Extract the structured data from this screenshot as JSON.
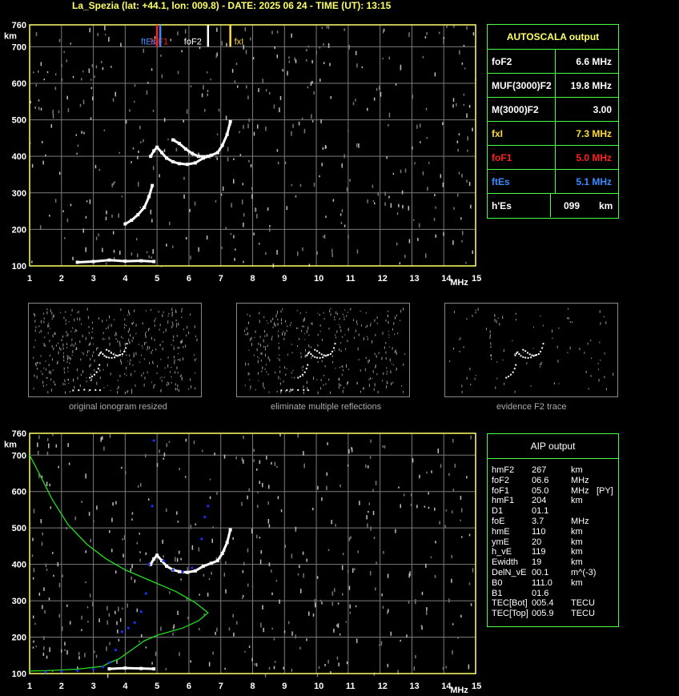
{
  "header": {
    "title": "La_Spezia (lat: +44.1, lon: 009.8) - DATE: 2025 06 24 - TIME (UT): 13:15"
  },
  "colors": {
    "axis": "#ffff66",
    "grid": "#7a7a7a",
    "panel_border": "#44ff44",
    "trace": "#ffffff",
    "foF1": "#ff2020",
    "ftEs": "#3a8cff",
    "fxI": "#ffdd33",
    "profile": "#22dd22",
    "aip_points": "#1a2fff"
  },
  "autoscala": {
    "title": "AUTOSCALA output",
    "rows": [
      {
        "key": "foF2",
        "value": "6.6 MHz",
        "color": "#ffffff"
      },
      {
        "key": "MUF(3000)F2",
        "value": "19.8 MHz",
        "color": "#ffffff"
      },
      {
        "key": "M(3000)F2",
        "value": "3.00",
        "color": "#ffffff"
      },
      {
        "key": "fxI",
        "value": "7.3 MHz",
        "color": "#ffdd33"
      },
      {
        "key": "foF1",
        "value": "5.0 MHz",
        "color": "#ff2020"
      },
      {
        "key": "ftEs",
        "value": "5.1 MHz",
        "color": "#3a8cff"
      },
      {
        "key": "h'Es",
        "value": "099",
        "unit": "km",
        "color": "#ffffff"
      }
    ]
  },
  "aip": {
    "title": "AIP output",
    "rows": [
      [
        "hmF2",
        "267",
        "km",
        ""
      ],
      [
        "foF2",
        "06.6",
        "MHz",
        ""
      ],
      [
        "foF1",
        "05.0",
        "MHz",
        "[PY]"
      ],
      [
        "hmF1",
        "204",
        "km",
        ""
      ],
      [
        "D1",
        "01.1",
        "",
        ""
      ],
      [
        "foE",
        "3.7",
        "MHz",
        ""
      ],
      [
        "hmE",
        "110",
        "km",
        ""
      ],
      [
        "ymE",
        "20",
        "km",
        ""
      ],
      [
        "h_vE",
        "119",
        "km",
        ""
      ],
      [
        "Ewidth",
        "19",
        "km",
        ""
      ],
      [
        "DelN_vE",
        "00.1",
        "m^(-3)",
        ""
      ],
      [
        "B0",
        "111.0",
        "km",
        ""
      ],
      [
        "B1",
        "01.6",
        "",
        ""
      ],
      [
        "TEC[Bot]",
        "005.4",
        "TECU",
        ""
      ],
      [
        "TEC[Top]",
        "005.9",
        "TECU",
        ""
      ]
    ]
  },
  "thumbnails": [
    {
      "caption": "original ionogram resized"
    },
    {
      "caption": "eliminate multiple reflections"
    },
    {
      "caption": "evidence F2 trace"
    }
  ],
  "chart_data": [
    {
      "type": "scatter",
      "name": "ionogram_top",
      "xunit": "MHz",
      "yunit": "km",
      "xlim": [
        1,
        15
      ],
      "ylim": [
        100,
        760
      ],
      "xticks": [
        "1",
        "2",
        "3",
        "4",
        "5",
        "6",
        "7",
        "8",
        "9",
        "10",
        "11",
        "12",
        "13",
        "14",
        "15"
      ],
      "yticks": [
        "100",
        "200",
        "300",
        "400",
        "500",
        "600",
        "700",
        "760"
      ],
      "markers": [
        {
          "label": "foF1",
          "x": 5.0,
          "color": "#ff2020"
        },
        {
          "label": "ftEs",
          "x": 5.1,
          "color": "#3a8cff"
        },
        {
          "label": "foF2",
          "x": 6.6,
          "color": "#ffffff"
        },
        {
          "label": "fxI",
          "x": 7.3,
          "color": "#ffdd33"
        }
      ],
      "traces": [
        {
          "name": "Es",
          "points": [
            [
              2.5,
              110
            ],
            [
              3.0,
              112
            ],
            [
              3.5,
              116
            ],
            [
              4.0,
              113
            ],
            [
              4.5,
              114
            ],
            [
              4.9,
              112
            ]
          ]
        },
        {
          "name": "F1",
          "points": [
            [
              4.0,
              215
            ],
            [
              4.2,
              225
            ],
            [
              4.4,
              240
            ],
            [
              4.6,
              260
            ],
            [
              4.75,
              290
            ],
            [
              4.85,
              320
            ]
          ]
        },
        {
          "name": "F2",
          "points": [
            [
              4.8,
              400
            ],
            [
              4.9,
              415
            ],
            [
              5.0,
              425
            ],
            [
              5.15,
              410
            ],
            [
              5.3,
              395
            ],
            [
              5.5,
              385
            ],
            [
              5.7,
              380
            ],
            [
              5.95,
              378
            ],
            [
              6.2,
              382
            ],
            [
              6.45,
              395
            ],
            [
              6.7,
              403
            ],
            [
              6.9,
              410
            ],
            [
              7.05,
              430
            ],
            [
              7.2,
              460
            ],
            [
              7.3,
              495
            ]
          ]
        },
        {
          "name": "F2x",
          "points": [
            [
              5.5,
              445
            ],
            [
              5.7,
              435
            ],
            [
              5.9,
              420
            ],
            [
              6.1,
              408
            ],
            [
              6.3,
              400
            ],
            [
              6.6,
              400
            ]
          ]
        }
      ]
    },
    {
      "type": "scatter",
      "name": "ionogram_bottom",
      "xunit": "MHz",
      "yunit": "km",
      "xlim": [
        1,
        15
      ],
      "ylim": [
        100,
        760
      ],
      "xticks": [
        "1",
        "2",
        "3",
        "4",
        "5",
        "6",
        "7",
        "8",
        "9",
        "10",
        "11",
        "12",
        "13",
        "14",
        "15"
      ],
      "yticks": [
        "100",
        "200",
        "300",
        "400",
        "500",
        "600",
        "700",
        "760"
      ],
      "profile": [
        [
          1.0,
          700
        ],
        [
          1.3,
          650
        ],
        [
          1.7,
          580
        ],
        [
          2.2,
          510
        ],
        [
          2.8,
          455
        ],
        [
          3.4,
          415
        ],
        [
          4.0,
          385
        ],
        [
          4.8,
          355
        ],
        [
          5.6,
          325
        ],
        [
          6.2,
          295
        ],
        [
          6.6,
          267
        ],
        [
          6.3,
          245
        ],
        [
          5.8,
          225
        ],
        [
          5.0,
          205
        ],
        [
          4.6,
          190
        ],
        [
          4.2,
          165
        ],
        [
          3.8,
          140
        ],
        [
          3.5,
          130
        ],
        [
          3.3,
          120
        ],
        [
          2.5,
          112
        ],
        [
          1.5,
          108
        ],
        [
          1.0,
          107
        ]
      ],
      "traces": [
        {
          "name": "Es",
          "points": [
            [
              3.5,
              113
            ],
            [
              4.0,
              115
            ],
            [
              4.5,
              114
            ],
            [
              4.9,
              113
            ]
          ]
        },
        {
          "name": "F2",
          "points": [
            [
              4.8,
              400
            ],
            [
              4.9,
              415
            ],
            [
              5.0,
              425
            ],
            [
              5.15,
              410
            ],
            [
              5.3,
              395
            ],
            [
              5.5,
              385
            ],
            [
              5.7,
              380
            ],
            [
              5.95,
              378
            ],
            [
              6.2,
              382
            ],
            [
              6.45,
              395
            ],
            [
              6.7,
              403
            ],
            [
              6.9,
              410
            ],
            [
              7.05,
              430
            ],
            [
              7.2,
              460
            ],
            [
              7.3,
              495
            ]
          ]
        }
      ],
      "aip_points": [
        [
          1.5,
          104
        ],
        [
          2.0,
          106
        ],
        [
          2.5,
          108
        ],
        [
          3.0,
          112
        ],
        [
          3.3,
          118
        ],
        [
          3.5,
          130
        ],
        [
          3.7,
          165
        ],
        [
          3.9,
          215
        ],
        [
          4.1,
          225
        ],
        [
          4.3,
          240
        ],
        [
          4.5,
          270
        ],
        [
          4.65,
          320
        ],
        [
          4.75,
          400
        ],
        [
          4.85,
          560
        ],
        [
          4.9,
          740
        ],
        [
          5.2,
          410
        ],
        [
          5.5,
          385
        ],
        [
          5.8,
          380
        ],
        [
          6.1,
          390
        ],
        [
          6.4,
          470
        ],
        [
          6.5,
          530
        ],
        [
          6.6,
          560
        ]
      ]
    }
  ]
}
